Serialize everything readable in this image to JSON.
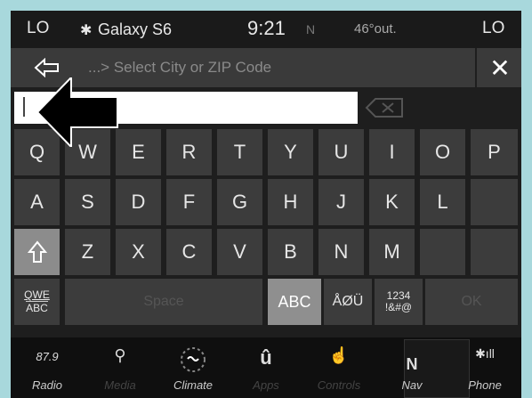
{
  "status": {
    "lo_left": "LO",
    "bt_icon": "bluetooth-icon",
    "device": "Galaxy S6",
    "time": "9:21",
    "compass": "N",
    "temp": "46°out.",
    "lo_right": "LO"
  },
  "header": {
    "back_icon": "back-arrow-icon",
    "title": "...> Select City or ZIP Code",
    "close": "✕"
  },
  "input": {
    "value": ""
  },
  "keyboard": {
    "row1": [
      "Q",
      "W",
      "E",
      "R",
      "T",
      "Y",
      "U",
      "I",
      "O",
      "P"
    ],
    "row2": [
      "A",
      "S",
      "D",
      "F",
      "G",
      "H",
      "J",
      "K",
      "L",
      ""
    ],
    "row3": [
      "Z",
      "X",
      "C",
      "V",
      "B",
      "N",
      "M",
      "",
      ""
    ],
    "qwe": "QWE",
    "abc_small": "ABC",
    "space": "Space",
    "abc": "ABC",
    "accents": "ÅØÜ",
    "num1": "1234",
    "num2": "!&#@",
    "ok": "OK"
  },
  "nav": {
    "radio_freq": "87.9",
    "radio": "Radio",
    "media": "Media",
    "climate": "Climate",
    "apps": "Apps",
    "controls": "Controls",
    "nav_letter": "N",
    "nav": "Nav",
    "phone": "Phone"
  },
  "colors": {
    "background": "#a8d8dc",
    "key": "#3c3c3c",
    "key_active": "#8f8f8f"
  }
}
